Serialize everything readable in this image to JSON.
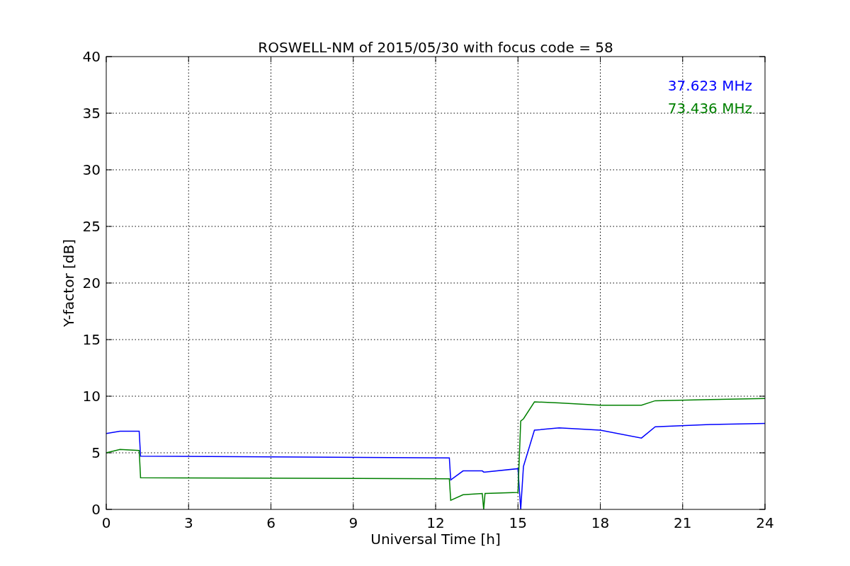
{
  "figure": {
    "chart_data": {
      "type": "line",
      "title": "ROSWELL-NM of 2015/05/30 with focus code = 58",
      "xlabel": "Universal Time [h]",
      "ylabel": "Y-factor [dB]",
      "x": [
        0,
        0.5,
        1.2,
        1.25,
        12.5,
        12.55,
        13,
        13.7,
        13.75,
        13.8,
        15,
        15.1,
        15.2,
        15.6,
        16.5,
        18,
        19.5,
        20,
        22,
        24
      ],
      "series": [
        {
          "name": "37.623 MHz",
          "color": "#0000ff",
          "values": [
            6.7,
            6.9,
            6.9,
            4.7,
            4.55,
            2.6,
            3.4,
            3.4,
            3.3,
            3.3,
            3.6,
            0,
            3.8,
            7,
            7.2,
            7,
            6.3,
            7.3,
            7.5,
            7.6
          ]
        },
        {
          "name": "73.436 MHz",
          "color": "#008000",
          "values": [
            5.0,
            5.3,
            5.2,
            2.8,
            2.7,
            0.8,
            1.3,
            1.4,
            0,
            1.4,
            1.5,
            7.8,
            8.0,
            9.5,
            9.4,
            9.2,
            9.2,
            9.6,
            9.7,
            9.8
          ]
        }
      ],
      "grid": true,
      "xlim": [
        0,
        24
      ],
      "ylim": [
        0,
        40
      ],
      "xticks": [
        0,
        3,
        6,
        9,
        12,
        15,
        18,
        21,
        24
      ],
      "yticks": [
        0,
        5,
        10,
        15,
        20,
        25,
        30,
        35,
        40
      ]
    }
  }
}
